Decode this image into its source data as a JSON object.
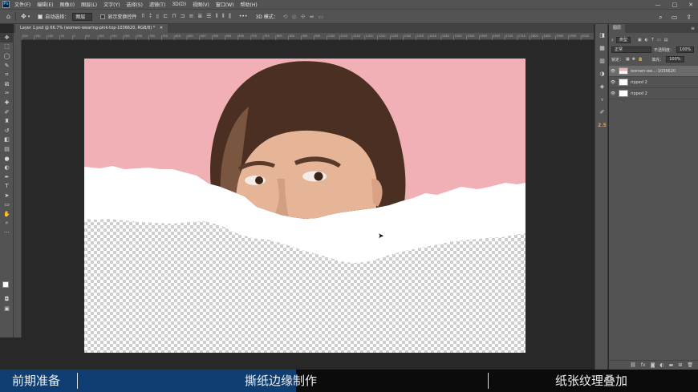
{
  "app": {
    "logo_text": "Ps",
    "menu": [
      "文件(F)",
      "编辑(E)",
      "图像(I)",
      "图层(L)",
      "文字(Y)",
      "选择(S)",
      "滤镜(T)",
      "3D(D)",
      "视图(V)",
      "窗口(W)",
      "帮助(H)"
    ],
    "window_controls": [
      "—",
      "□",
      "✕"
    ]
  },
  "options_bar": {
    "auto_select_label": "自动选择：",
    "auto_select_value": "图层",
    "show_transform_label": "显示变换控件",
    "more_label": "•••",
    "threeD_mode_label": "3D 模式："
  },
  "document": {
    "tab_title": "Layer 1.psd @ 66.7% (women-wearing-pink-top-1036620, RGB/8) *",
    "ruler_marks": [
      "200",
      "150",
      "100",
      "50",
      "0",
      "50",
      "100",
      "150",
      "200",
      "250",
      "300",
      "350",
      "400",
      "450",
      "500",
      "550",
      "600",
      "650",
      "700",
      "750",
      "800",
      "850",
      "900",
      "950",
      "1000",
      "1050",
      "1100",
      "1150",
      "1200",
      "1250",
      "1300",
      "1350",
      "1400",
      "1450",
      "1500",
      "1550",
      "1600",
      "1650",
      "1700",
      "1750",
      "1800",
      "1850",
      "1900",
      "1950",
      "2000"
    ]
  },
  "panel_strip": {
    "badge": "2.5"
  },
  "layers_panel": {
    "tab_label": "图层",
    "kind_label": "类型",
    "blend_mode": "正常",
    "opacity_label": "不透明度：",
    "opacity_value": "100%",
    "lock_label": "锁定：",
    "fill_label": "填充：",
    "fill_value": "100%",
    "layers": [
      {
        "name": "women-we...-1036620",
        "selected": true,
        "thumb": "photo"
      },
      {
        "name": "ripped 2",
        "selected": false,
        "thumb": "white"
      },
      {
        "name": "ripped 2",
        "selected": false,
        "thumb": "white"
      }
    ]
  },
  "bottom_bar": {
    "step1": "前期准备",
    "step2": "撕纸边缘制作",
    "step3": "纸张纹理叠加",
    "progress": 0.424
  },
  "colors": {
    "ui_bg": "#535353",
    "canvas_bg": "#282828",
    "photo_pink": "#f1b0b6",
    "progress_blue": "#0f3e72"
  }
}
